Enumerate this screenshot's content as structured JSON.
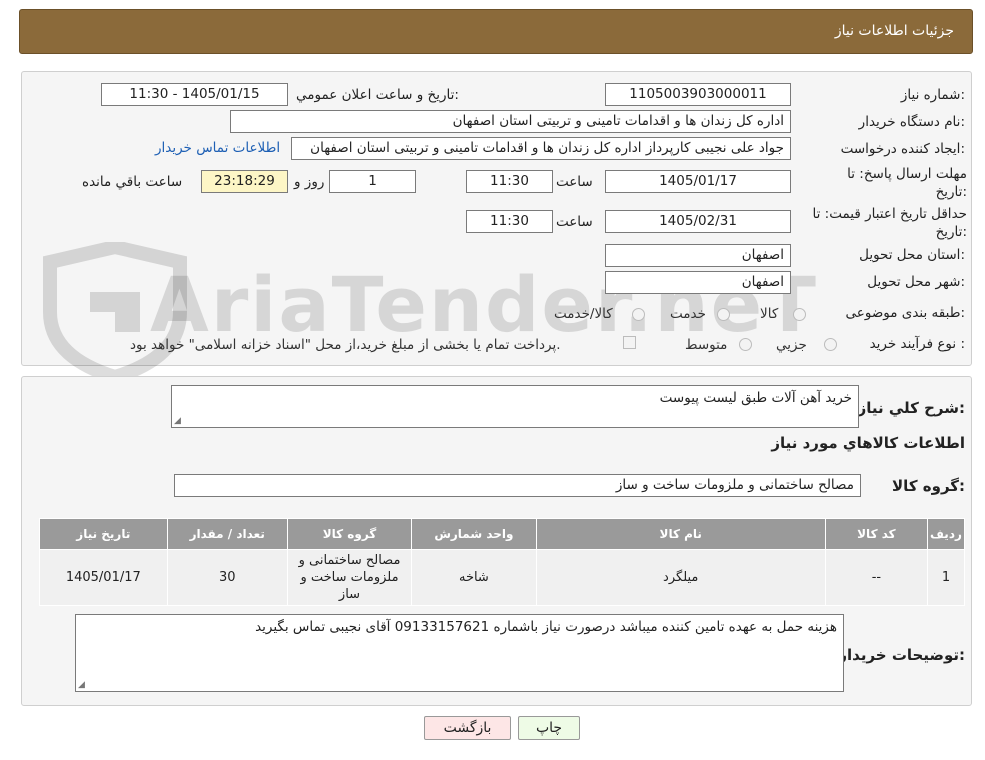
{
  "header": {
    "title": "جزئیات اطلاعات نیاز"
  },
  "form": {
    "need_number_label": "شماره نیاز:",
    "need_number": "1105003903000011",
    "announce_label": "تاریخ و ساعت اعلان عمومي:",
    "announce_value": "1405/01/15 - 11:30",
    "buyer_org_label": "نام دستگاه خريدار:",
    "buyer_org": "اداره کل زندان ها و اقدامات تامینی و تربیتی استان اصفهان",
    "requester_label": "ايجاد کننده درخواست:",
    "requester": "جواد علی نجیبی کارپرداز اداره کل زندان ها و اقدامات تامینی و تربیتی استان اصفهان",
    "buyer_contact_link": "اطلاعات تماس خريدار",
    "reply_deadline_label": "مهلت ارسال پاسخ: تا تاریخ:",
    "reply_date": "1405/01/17",
    "time_label": "ساعت",
    "reply_time": "11:30",
    "days_value": "1",
    "days_label": "روز و",
    "remaining_time": "23:18:29",
    "remaining_label": "ساعت باقي مانده",
    "price_validity_label": "حداقل تاريخ اعتبار قيمت: تا تاريخ:",
    "price_validity_date": "1405/02/31",
    "price_validity_time": "11:30",
    "province_label": "استان محل تحويل:",
    "province": "اصفهان",
    "city_label": "شهر محل تحويل:",
    "city": "اصفهان",
    "category_label": "طبقه بندی موضوعی:",
    "category_options": [
      "کالا",
      "خدمت",
      "کالا/خدمت"
    ],
    "process_label": "نوع فرآيند خريد :",
    "process_options": [
      "جزيي",
      "متوسط"
    ],
    "payment_note": "پرداخت تمام يا بخشی از مبلغ خريد،از محل \"اسناد خزانه اسلامی\" خواهد بود."
  },
  "description": {
    "label": "شرح کلي نياز:",
    "value": "خرید آهن آلات طبق لیست پیوست"
  },
  "goods_info_title": "اطلاعات کالاهاي مورد نياز",
  "goods_group": {
    "label": "گروه کالا:",
    "value": "مصالح ساختمانی و ملزومات ساخت و ساز"
  },
  "table": {
    "headers": [
      "رديف",
      "کد کالا",
      "نام کالا",
      "واحد شمارش",
      "گروه کالا",
      "تعداد / مقدار",
      "تاریخ نیاز"
    ],
    "rows": [
      [
        "1",
        "--",
        "میلگرد",
        "شاخه",
        "مصالح ساختمانی و ملزومات ساخت و ساز",
        "30",
        "1405/01/17"
      ]
    ]
  },
  "buyer_notes": {
    "label": "توضيحات خريدار:",
    "value": "هزینه حمل به عهده تامین کننده میباشد درصورت نیاز باشماره 09133157621 آقای نجیبی تماس بگیرید"
  },
  "buttons": {
    "print": "چاپ",
    "back": "بازگشت"
  },
  "colors": {
    "header": "#8b6a3a",
    "link": "#1d5fb4",
    "print_btn": "#eefbe6",
    "back_btn": "#fde6e6"
  }
}
